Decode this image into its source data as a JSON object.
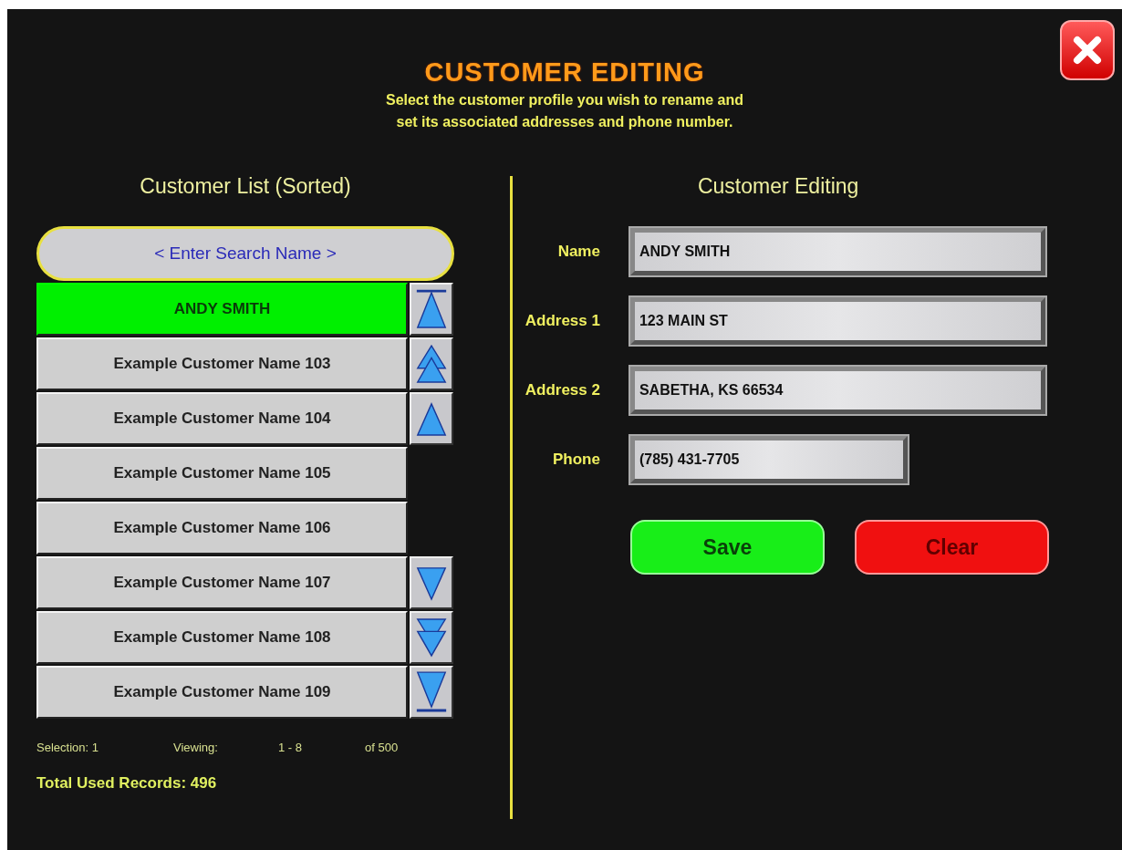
{
  "header": {
    "title": "CUSTOMER EDITING",
    "subtitle_lines": [
      "Select the customer profile you wish to rename and",
      "set its associated addresses and phone number."
    ]
  },
  "customer_list": {
    "heading": "Customer List (Sorted)",
    "search": {
      "placeholder": "< Enter Search Name >"
    },
    "customers": [
      {
        "name": "ANDY SMITH",
        "selected": true
      },
      {
        "name": "Example Customer Name 103",
        "selected": false
      },
      {
        "name": "Example Customer Name 104",
        "selected": false
      },
      {
        "name": "Example Customer Name 105",
        "selected": false
      },
      {
        "name": "Example Customer Name 106",
        "selected": false
      },
      {
        "name": "Example Customer Name 107",
        "selected": false
      },
      {
        "name": "Example Customer Name 108",
        "selected": false
      },
      {
        "name": "Example Customer Name 109",
        "selected": false
      }
    ],
    "scroll_buttons": [
      {
        "kind": "top"
      },
      {
        "kind": "page_up"
      },
      {
        "kind": "up"
      },
      {
        "kind": "down"
      },
      {
        "kind": "page_down"
      },
      {
        "kind": "bottom"
      }
    ],
    "status": {
      "selection": "Selection: 1",
      "viewing_label": "Viewing:",
      "viewing_range": "1 - 8",
      "total": "of 500"
    },
    "total_used": "Total Used Records: 496"
  },
  "customer_editing": {
    "heading": "Customer Editing",
    "fields": [
      {
        "label": "Name",
        "value": "ANDY SMITH",
        "kind": "wide"
      },
      {
        "label": "Address 1",
        "value": "123 MAIN ST",
        "kind": "wide"
      },
      {
        "label": "Address 2",
        "value": "SABETHA, KS 66534",
        "kind": "wide"
      },
      {
        "label": "Phone",
        "value": "(785) 431-7705",
        "kind": "short"
      }
    ],
    "buttons": [
      {
        "label": "Save",
        "kind": "save"
      },
      {
        "label": "Clear",
        "kind": "clear"
      }
    ]
  }
}
